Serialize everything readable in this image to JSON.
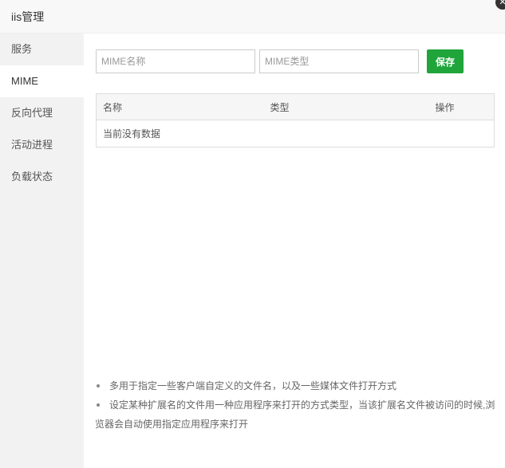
{
  "window": {
    "title": "iis管理",
    "close_label": "✕"
  },
  "sidebar": {
    "items": [
      {
        "label": "服务"
      },
      {
        "label": "MIME"
      },
      {
        "label": "反向代理"
      },
      {
        "label": "活动进程"
      },
      {
        "label": "负载状态"
      }
    ],
    "active": "MIME"
  },
  "form": {
    "name_placeholder": "MIME名称",
    "type_placeholder": "MIME类型",
    "save_label": "保存"
  },
  "table": {
    "headers": [
      "名称",
      "类型",
      "操作"
    ],
    "empty_text": "当前没有数据"
  },
  "notes": [
    "多用于指定一些客户端自定义的文件名，以及一些媒体文件打开方式",
    "设定某种扩展名的文件用一种应用程序来打开的方式类型，当该扩展名文件被访问的时候,浏览器会自动使用指定应用程序来打开"
  ],
  "colors": {
    "accent": "#20a53a"
  }
}
